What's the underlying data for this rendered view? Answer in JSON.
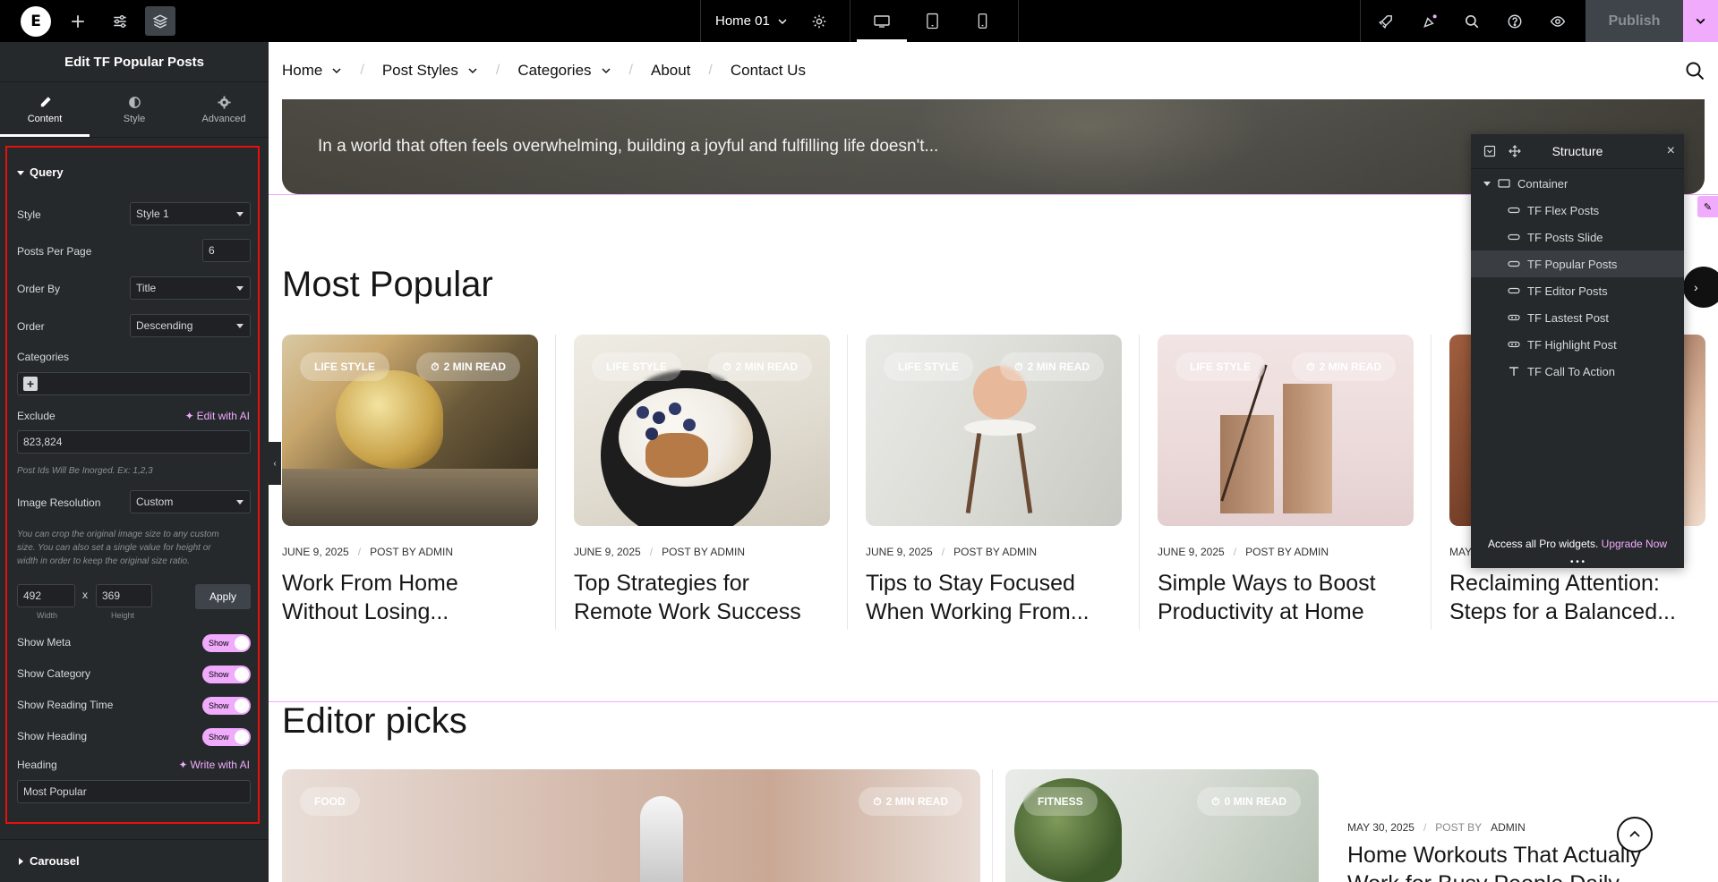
{
  "topbar": {
    "page_name": "Home 01",
    "publish_label": "Publish"
  },
  "panel": {
    "title": "Edit TF Popular Posts",
    "tabs": [
      {
        "label": "Content",
        "icon": "pencil-icon"
      },
      {
        "label": "Style",
        "icon": "half-circle-icon"
      },
      {
        "label": "Advanced",
        "icon": "gear-icon"
      }
    ],
    "query": {
      "section_label": "Query",
      "style_label": "Style",
      "style_value": "Style 1",
      "posts_per_page_label": "Posts Per Page",
      "posts_per_page_value": "6",
      "order_by_label": "Order By",
      "order_by_value": "Title",
      "order_label": "Order",
      "order_value": "Descending",
      "categories_label": "Categories",
      "exclude_label": "Exclude",
      "edit_with_ai": "Edit with AI",
      "exclude_value": "823,824",
      "exclude_hint": "Post Ids Will Be Inorged. Ex: 1,2,3",
      "image_resolution_label": "Image Resolution",
      "image_resolution_value": "Custom",
      "image_hint_1": "You can crop the original image size to any custom",
      "image_hint_2": "size. You can also set a single value for height or",
      "image_hint_3": "width in order to keep the original size ratio.",
      "width_value": "492",
      "height_value": "369",
      "x_sep": "x",
      "width_label": "Width",
      "height_label": "Height",
      "apply_label": "Apply",
      "show_meta_label": "Show Meta",
      "show_category_label": "Show Category",
      "show_reading_time_label": "Show Reading Time",
      "show_heading_label": "Show Heading",
      "toggle_text": "Show",
      "heading_label": "Heading",
      "write_with_ai": "Write with AI",
      "heading_value": "Most Popular"
    },
    "carousel_label": "Carousel"
  },
  "site": {
    "nav": [
      {
        "label": "Home",
        "has_caret": true
      },
      {
        "label": "Post Styles",
        "has_caret": true
      },
      {
        "label": "Categories",
        "has_caret": true
      },
      {
        "label": "About",
        "has_caret": false
      },
      {
        "label": "Contact Us",
        "has_caret": false
      }
    ],
    "hero_text": "In a world that often feels overwhelming, building a joyful and fulfilling life doesn't...",
    "most_popular_heading": "Most Popular",
    "editor_picks_heading": "Editor picks",
    "cards": [
      {
        "category": "LIFE STYLE",
        "read": "2 MIN READ",
        "date": "JUNE 9, 2025",
        "by": "POST BY ADMIN",
        "title": "Work From Home Without Losing..."
      },
      {
        "category": "LIFE STYLE",
        "read": "2 MIN READ",
        "date": "JUNE 9, 2025",
        "by": "POST BY ADMIN",
        "title": "Top Strategies for Remote Work Success"
      },
      {
        "category": "LIFE STYLE",
        "read": "2 MIN READ",
        "date": "JUNE 9, 2025",
        "by": "POST BY ADMIN",
        "title": "Tips to Stay Focused When Working From..."
      },
      {
        "category": "LIFE STYLE",
        "read": "2 MIN READ",
        "date": "JUNE 9, 2025",
        "by": "POST BY ADMIN",
        "title": "Simple Ways to Boost Productivity at Home"
      },
      {
        "category": "",
        "read": "",
        "date": "MAY",
        "by": "",
        "title": "Reclaiming Attention: Steps for a Balanced..."
      }
    ],
    "editor_cards": [
      {
        "category": "FOOD",
        "read": "2 MIN READ"
      },
      {
        "category": "FITNESS",
        "read": "0 MIN READ"
      }
    ],
    "editor_feature": {
      "date": "MAY 30, 2025",
      "by_prefix": "POST BY",
      "by_name": "ADMIN",
      "title": "Home Workouts That Actually Work for Busy People Daily"
    }
  },
  "structure": {
    "title": "Structure",
    "root": "Container",
    "items": [
      {
        "label": "TF Flex Posts",
        "icon": "widget-icon"
      },
      {
        "label": "TF Posts Slide",
        "icon": "widget-icon"
      },
      {
        "label": "TF Popular Posts",
        "icon": "widget-icon",
        "active": true
      },
      {
        "label": "TF Editor Posts",
        "icon": "widget-icon"
      },
      {
        "label": "TF Lastest Post",
        "icon": "dots-widget-icon"
      },
      {
        "label": "TF Highlight Post",
        "icon": "dots-widget-icon"
      },
      {
        "label": "TF Call To Action",
        "icon": "heading-icon"
      }
    ],
    "footer_text": "Access all Pro widgets.",
    "upgrade_label": "Upgrade Now"
  },
  "colors": {
    "accent": "#f0abfc",
    "panel_bg": "#26292c",
    "highlight_frame": "#e5100c"
  }
}
